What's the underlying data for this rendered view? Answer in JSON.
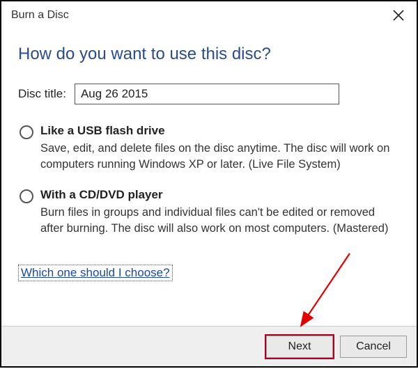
{
  "window": {
    "title": "Burn a Disc"
  },
  "heading": "How do you want to use this disc?",
  "disc_title": {
    "label": "Disc title:",
    "value": "Aug 26 2015"
  },
  "options": [
    {
      "title": "Like a USB flash drive",
      "description": "Save, edit, and delete files on the disc anytime. The disc will work on computers running Windows XP or later. (Live File System)"
    },
    {
      "title": "With a CD/DVD player",
      "description": "Burn files in groups and individual files can't be edited or removed after burning. The disc will also work on most computers. (Mastered)"
    }
  ],
  "help_link": "Which one should I choose?",
  "footer": {
    "next": "Next",
    "cancel": "Cancel"
  }
}
